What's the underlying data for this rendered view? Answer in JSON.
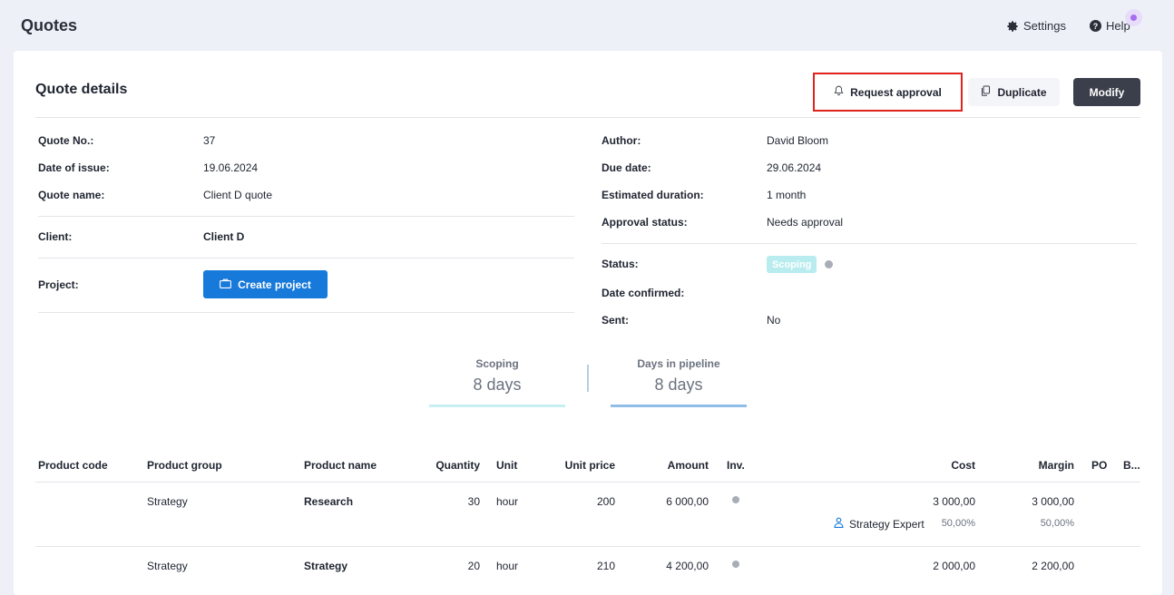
{
  "header": {
    "title": "Quotes",
    "settings_label": "Settings",
    "help_label": "Help"
  },
  "card": {
    "title": "Quote details",
    "actions": {
      "request_approval": "Request approval",
      "duplicate": "Duplicate",
      "modify": "Modify"
    }
  },
  "details_left": {
    "quote_no_label": "Quote No.:",
    "quote_no": "37",
    "date_issue_label": "Date of issue:",
    "date_issue": "19.06.2024",
    "quote_name_label": "Quote name:",
    "quote_name": "Client D quote",
    "client_label": "Client:",
    "client": "Client D",
    "project_label": "Project:",
    "create_project": "Create project"
  },
  "details_right": {
    "author_label": "Author:",
    "author": "David Bloom",
    "due_date_label": "Due date:",
    "due_date": "29.06.2024",
    "duration_label": "Estimated duration:",
    "duration": "1 month",
    "approval_label": "Approval status:",
    "approval": "Needs approval",
    "status_label": "Status:",
    "status": "Scoping",
    "date_confirmed_label": "Date confirmed:",
    "date_confirmed": "",
    "sent_label": "Sent:",
    "sent": "No"
  },
  "stats": [
    {
      "label": "Scoping",
      "value": "8 days",
      "bar_color": "#c7eef1"
    },
    {
      "label": "Days in pipeline",
      "value": "8 days",
      "bar_color": "#8fbde6"
    }
  ],
  "colors": {
    "primary": "#1779d9",
    "dark_button": "#3a3f4b",
    "highlight": "#e0231d",
    "status_badge": "#b8ecef"
  },
  "table": {
    "headers": {
      "product_code": "Product code",
      "product_group": "Product group",
      "product_name": "Product name",
      "quantity": "Quantity",
      "unit": "Unit",
      "unit_price": "Unit price",
      "amount": "Amount",
      "inv": "Inv.",
      "cost": "Cost",
      "margin": "Margin",
      "po": "PO",
      "b": "B..."
    },
    "rows": [
      {
        "product_code": "",
        "product_group": "Strategy",
        "product_name": "Research",
        "quantity": "30",
        "unit": "hour",
        "unit_price": "200",
        "amount": "6 000,00",
        "cost": "3 000,00",
        "margin": "3 000,00",
        "resource": "Strategy Expert",
        "cost_pct": "50,00%",
        "margin_pct": "50,00%"
      },
      {
        "product_code": "",
        "product_group": "Strategy",
        "product_name": "Strategy",
        "quantity": "20",
        "unit": "hour",
        "unit_price": "210",
        "amount": "4 200,00",
        "cost": "2 000,00",
        "margin": "2 200,00"
      }
    ]
  }
}
